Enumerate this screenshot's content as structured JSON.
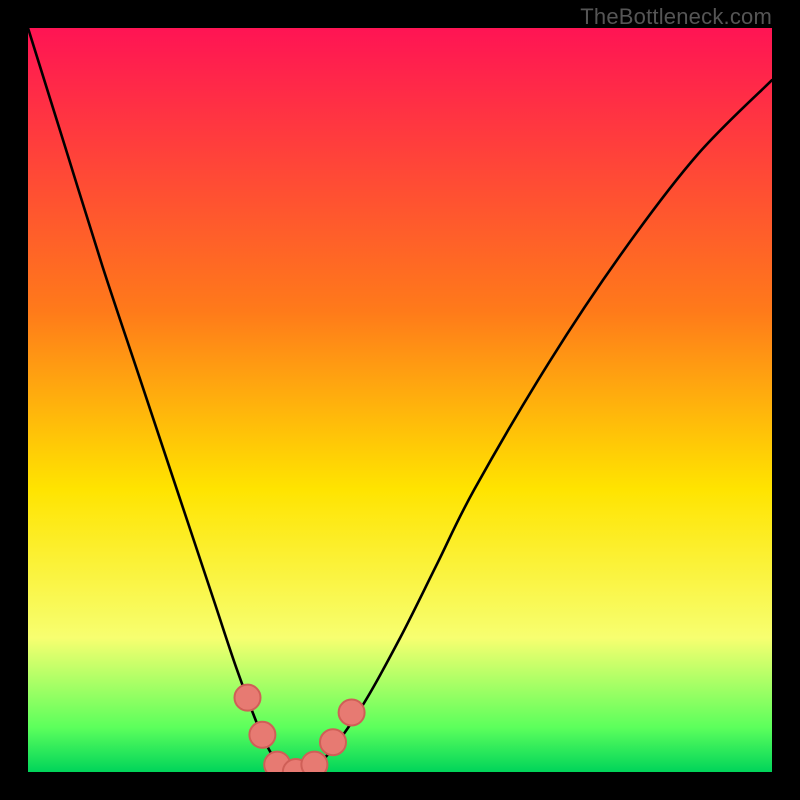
{
  "watermark": {
    "text": "TheBottleneck.com"
  },
  "colors": {
    "black": "#000000",
    "top": "#ff1454",
    "upper_mid": "#ff7a1a",
    "mid": "#ffe400",
    "lower_mid": "#f7ff70",
    "green_top": "#5cff5c",
    "green_bottom": "#00d45a",
    "curve": "#000000",
    "marker_fill": "#e77a72",
    "marker_stroke": "#cf5f57"
  },
  "chart_data": {
    "type": "line",
    "title": "",
    "xlabel": "",
    "ylabel": "",
    "xlim": [
      0,
      100
    ],
    "ylim": [
      0,
      100
    ],
    "series": [
      {
        "name": "bottleneck-curve",
        "x": [
          0,
          5,
          10,
          15,
          20,
          25,
          28,
          31,
          33,
          35,
          37,
          40,
          45,
          50,
          55,
          60,
          70,
          80,
          90,
          100
        ],
        "values": [
          100,
          84,
          68,
          53,
          38,
          23,
          14,
          6,
          2,
          0,
          0,
          2,
          9,
          18,
          28,
          38,
          55,
          70,
          83,
          93
        ]
      }
    ],
    "markers": [
      {
        "name": "left-upper",
        "x": 29.5,
        "y": 10
      },
      {
        "name": "left-lower",
        "x": 31.5,
        "y": 5
      },
      {
        "name": "valley-left",
        "x": 33.5,
        "y": 1
      },
      {
        "name": "valley-mid",
        "x": 36.0,
        "y": 0
      },
      {
        "name": "valley-right",
        "x": 38.5,
        "y": 1
      },
      {
        "name": "right-lower",
        "x": 41.0,
        "y": 4
      },
      {
        "name": "right-upper",
        "x": 43.5,
        "y": 8
      }
    ],
    "gradient_stops": [
      {
        "offset": 0.0,
        "key": "top"
      },
      {
        "offset": 0.38,
        "key": "upper_mid"
      },
      {
        "offset": 0.62,
        "key": "mid"
      },
      {
        "offset": 0.82,
        "key": "lower_mid"
      },
      {
        "offset": 0.94,
        "key": "green_top"
      },
      {
        "offset": 1.0,
        "key": "green_bottom"
      }
    ]
  }
}
